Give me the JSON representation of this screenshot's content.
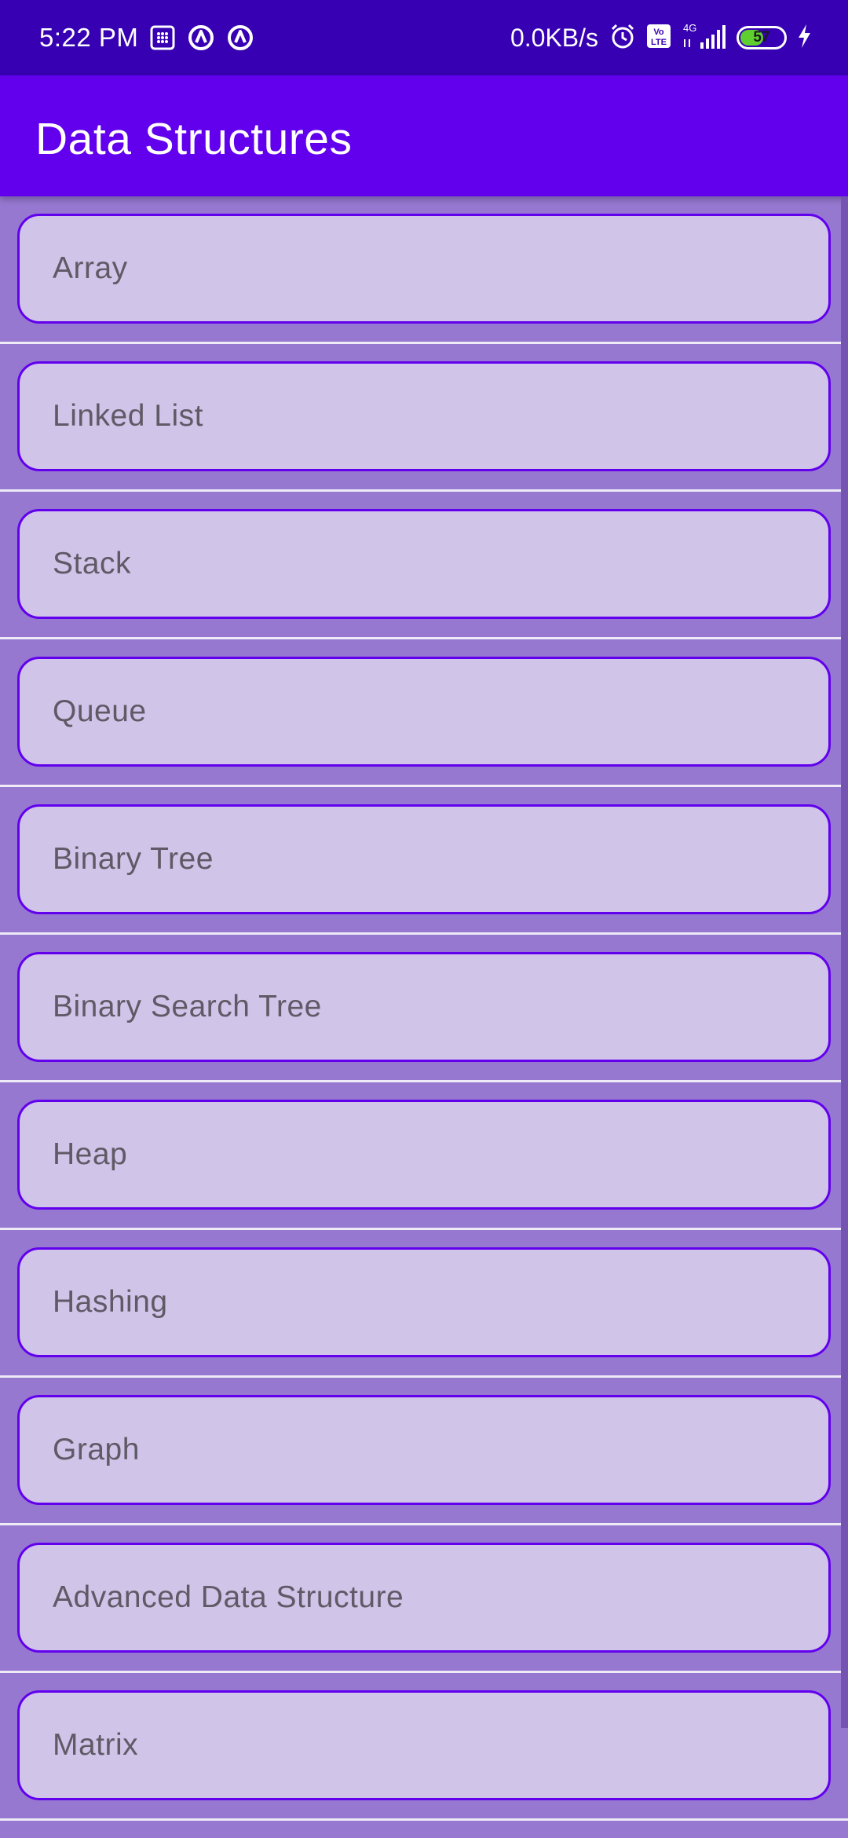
{
  "status_bar": {
    "time": "5:22 PM",
    "net_speed": "0.0KB/s",
    "network_label": "4G",
    "volte_label": "Vo LTE",
    "battery_level": "57",
    "battery_fraction": 0.57,
    "icons": [
      "calendar-icon",
      "assistant-icon",
      "assistant-icon",
      "alarm-icon",
      "volte-icon",
      "signal-icon",
      "battery-icon",
      "charging-icon"
    ]
  },
  "app_bar": {
    "title": "Data Structures",
    "background": "#6200ee"
  },
  "list": {
    "items": [
      {
        "label": "Array"
      },
      {
        "label": "Linked List"
      },
      {
        "label": "Stack"
      },
      {
        "label": "Queue"
      },
      {
        "label": "Binary Tree"
      },
      {
        "label": "Binary Search Tree"
      },
      {
        "label": "Heap"
      },
      {
        "label": "Hashing"
      },
      {
        "label": "Graph"
      },
      {
        "label": "Advanced Data Structure"
      },
      {
        "label": "Matrix"
      }
    ]
  },
  "colors": {
    "status_bar": "#3700b3",
    "primary": "#6200ee",
    "list_background": "#9678d1",
    "card_background": "#d0c4e8",
    "card_text": "#5f5a66"
  }
}
